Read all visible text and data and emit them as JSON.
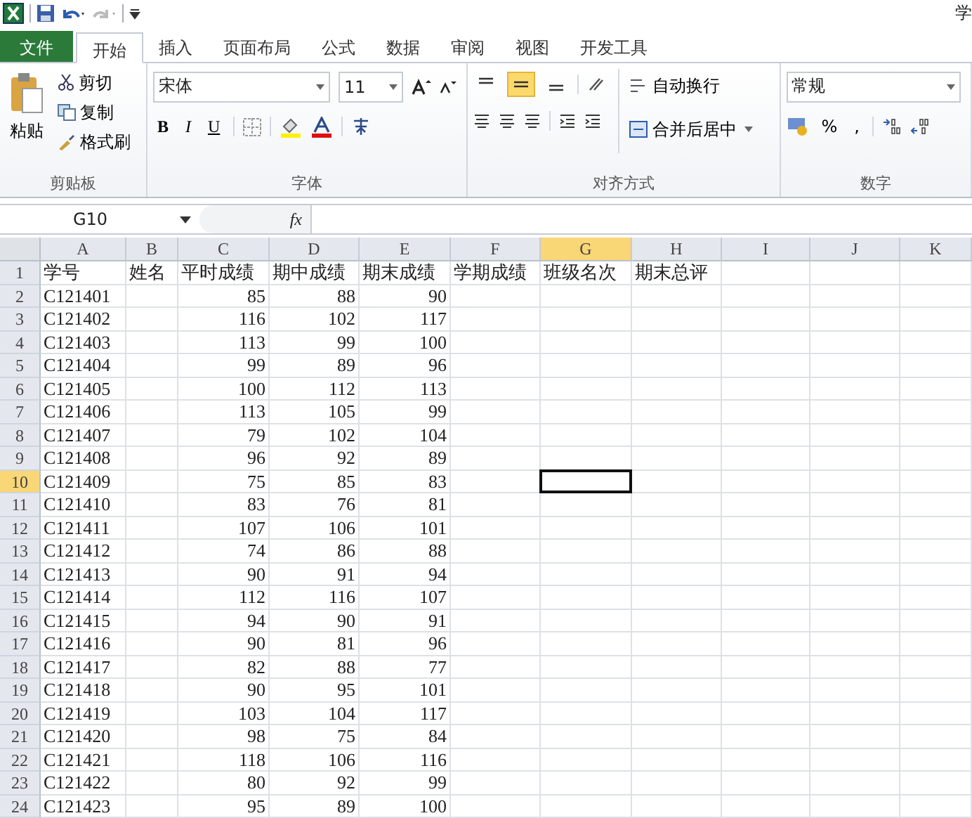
{
  "title_bar": {
    "title": "学"
  },
  "tabs": [
    {
      "label": "文件",
      "kind": "file",
      "selected": false
    },
    {
      "label": "开始",
      "kind": "tab",
      "selected": true
    },
    {
      "label": "插入",
      "kind": "tab",
      "selected": false
    },
    {
      "label": "页面布局",
      "kind": "tab",
      "selected": false
    },
    {
      "label": "公式",
      "kind": "tab",
      "selected": false
    },
    {
      "label": "数据",
      "kind": "tab",
      "selected": false
    },
    {
      "label": "审阅",
      "kind": "tab",
      "selected": false
    },
    {
      "label": "视图",
      "kind": "tab",
      "selected": false
    },
    {
      "label": "开发工具",
      "kind": "tab",
      "selected": false
    }
  ],
  "clipboard": {
    "paste": "粘贴",
    "cut": "剪切",
    "copy": "复制",
    "painter": "格式刷",
    "label": "剪贴板"
  },
  "font": {
    "name": "宋体",
    "size": "11",
    "bold": "B",
    "italic": "I",
    "underline": "U",
    "label": "字体"
  },
  "alignment": {
    "vertical": [
      {
        "selected": false
      },
      {
        "selected": true
      },
      {
        "selected": false
      }
    ],
    "wrap": "自动换行",
    "merge": "合并后居中",
    "label": "对齐方式"
  },
  "number": {
    "format": "常规",
    "percent": "%",
    "comma": ",",
    "label": "数字"
  },
  "formula_bar": {
    "name_box": "G10",
    "fx": "fx"
  },
  "columns": [
    {
      "label": "A",
      "selected": false
    },
    {
      "label": "B",
      "selected": false
    },
    {
      "label": "C",
      "selected": false
    },
    {
      "label": "D",
      "selected": false
    },
    {
      "label": "E",
      "selected": false
    },
    {
      "label": "F",
      "selected": false
    },
    {
      "label": "G",
      "selected": true
    },
    {
      "label": "H",
      "selected": false
    },
    {
      "label": "I",
      "selected": false
    },
    {
      "label": "J",
      "selected": false
    },
    {
      "label": "K",
      "selected": false
    }
  ],
  "header_row": {
    "row": "1",
    "selected": false,
    "cells": [
      "学号",
      "姓名",
      "平时成绩",
      "期中成绩",
      "期末成绩",
      "学期成绩",
      "班级名次",
      "期末总评"
    ]
  },
  "rows": [
    {
      "row": "2",
      "selected": false,
      "id": "C121401",
      "scores": [
        "85",
        "88",
        "90"
      ]
    },
    {
      "row": "3",
      "selected": false,
      "id": "C121402",
      "scores": [
        "116",
        "102",
        "117"
      ]
    },
    {
      "row": "4",
      "selected": false,
      "id": "C121403",
      "scores": [
        "113",
        "99",
        "100"
      ]
    },
    {
      "row": "5",
      "selected": false,
      "id": "C121404",
      "scores": [
        "99",
        "89",
        "96"
      ]
    },
    {
      "row": "6",
      "selected": false,
      "id": "C121405",
      "scores": [
        "100",
        "112",
        "113"
      ]
    },
    {
      "row": "7",
      "selected": false,
      "id": "C121406",
      "scores": [
        "113",
        "105",
        "99"
      ]
    },
    {
      "row": "8",
      "selected": false,
      "id": "C121407",
      "scores": [
        "79",
        "102",
        "104"
      ]
    },
    {
      "row": "9",
      "selected": false,
      "id": "C121408",
      "scores": [
        "96",
        "92",
        "89"
      ]
    },
    {
      "row": "10",
      "selected": true,
      "id": "C121409",
      "scores": [
        "75",
        "85",
        "83"
      ]
    },
    {
      "row": "11",
      "selected": false,
      "id": "C121410",
      "scores": [
        "83",
        "76",
        "81"
      ]
    },
    {
      "row": "12",
      "selected": false,
      "id": "C121411",
      "scores": [
        "107",
        "106",
        "101"
      ]
    },
    {
      "row": "13",
      "selected": false,
      "id": "C121412",
      "scores": [
        "74",
        "86",
        "88"
      ]
    },
    {
      "row": "14",
      "selected": false,
      "id": "C121413",
      "scores": [
        "90",
        "91",
        "94"
      ]
    },
    {
      "row": "15",
      "selected": false,
      "id": "C121414",
      "scores": [
        "112",
        "116",
        "107"
      ]
    },
    {
      "row": "16",
      "selected": false,
      "id": "C121415",
      "scores": [
        "94",
        "90",
        "91"
      ]
    },
    {
      "row": "17",
      "selected": false,
      "id": "C121416",
      "scores": [
        "90",
        "81",
        "96"
      ]
    },
    {
      "row": "18",
      "selected": false,
      "id": "C121417",
      "scores": [
        "82",
        "88",
        "77"
      ]
    },
    {
      "row": "19",
      "selected": false,
      "id": "C121418",
      "scores": [
        "90",
        "95",
        "101"
      ]
    },
    {
      "row": "20",
      "selected": false,
      "id": "C121419",
      "scores": [
        "103",
        "104",
        "117"
      ]
    },
    {
      "row": "21",
      "selected": false,
      "id": "C121420",
      "scores": [
        "98",
        "75",
        "84"
      ]
    },
    {
      "row": "22",
      "selected": false,
      "id": "C121421",
      "scores": [
        "118",
        "106",
        "116"
      ]
    },
    {
      "row": "23",
      "selected": false,
      "id": "C121422",
      "scores": [
        "80",
        "92",
        "99"
      ]
    },
    {
      "row": "24",
      "selected": false,
      "id": "C121423",
      "scores": [
        "95",
        "89",
        "100"
      ]
    }
  ]
}
